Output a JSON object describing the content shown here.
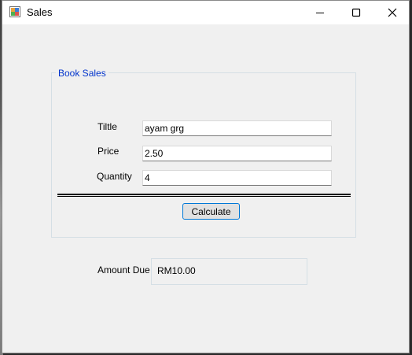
{
  "window": {
    "title": "Sales",
    "app_icon": "winforms-app-icon",
    "minimize_icon": "minimize-icon",
    "maximize_icon": "maximize-icon",
    "close_icon": "close-icon"
  },
  "group": {
    "legend": "Book Sales",
    "legend_color": "#0033cc"
  },
  "fields": {
    "title_label": "Tiltle",
    "title_value": "ayam grg",
    "price_label": "Price",
    "price_value": "2.50",
    "quantity_label": "Quantity",
    "quantity_value": "4"
  },
  "actions": {
    "calculate_label": "Calculate"
  },
  "result": {
    "amount_label": "Amount Due",
    "amount_value": "RM10.00"
  },
  "colors": {
    "window_bg": "#f0f0f0",
    "titlebar_bg": "#ffffff",
    "button_focus_border": "#0078d7"
  }
}
